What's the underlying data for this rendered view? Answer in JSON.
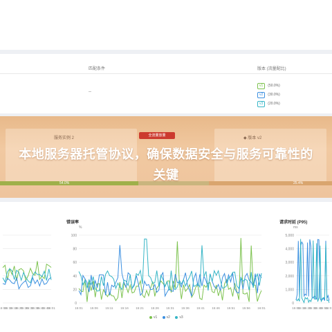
{
  "table": {
    "col_match": "匹配条件",
    "col_version": "版本 (流量配比)",
    "row_condition": "--",
    "versions": [
      {
        "tag": "v1",
        "pct": "(50.0%)",
        "color": "#7cc24e"
      },
      {
        "tag": "v2",
        "pct": "(30.0%)",
        "color": "#3b8fe0"
      },
      {
        "tag": "v3",
        "pct": "(20.0%)",
        "color": "#35b5c6"
      }
    ]
  },
  "status": {
    "left_label": "服务实例 2",
    "release_button": "全流量放量",
    "right_label": "◆ 版本 v2",
    "progress_left": "54.0%",
    "progress_right": "25.4%"
  },
  "headline": "本地服务器托管协议，确保数据安全与服务可靠性的关键",
  "charts": {
    "error_rate": {
      "title": "错误率",
      "unit": "%",
      "yticks": [
        "100",
        "80",
        "60",
        "40",
        "20",
        "0"
      ]
    },
    "latency": {
      "title": "请求时延 (P95)",
      "unit": "ms",
      "yticks": [
        "5,000",
        "4,000",
        "3,000",
        "2,000",
        "1,000",
        "0"
      ]
    },
    "xticks_left": [
      "15:06",
      "15:11",
      "15:16",
      "15:21",
      "15:26",
      "15:31",
      "15:36",
      "15:41",
      "15:46",
      "16:01"
    ],
    "xticks_mid": [
      "15:01",
      "15:06",
      "15:11",
      "15:16",
      "15:21",
      "15:26",
      "15:31",
      "15:36",
      "15:41",
      "15:46",
      "15:51",
      "15:56",
      "16:01"
    ],
    "xticks_right": [
      "15:01",
      "15:11",
      "15:21",
      "15:31",
      "15:41",
      "15:51",
      "16:01"
    ],
    "legend": [
      "v1",
      "v2",
      "v3"
    ],
    "colors": {
      "v1": "#7cc24e",
      "v2": "#3b8fe0",
      "v3": "#35b5c6"
    }
  }
}
